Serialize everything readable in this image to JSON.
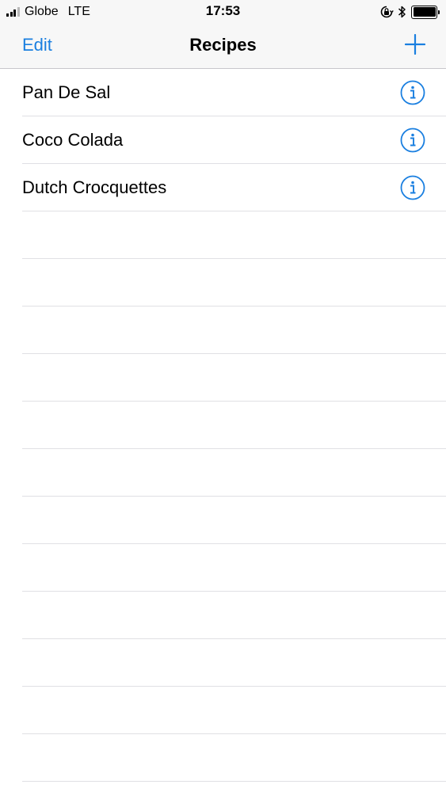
{
  "status_bar": {
    "carrier": "Globe",
    "network": "LTE",
    "time": "17:53",
    "signal_bars_active": 3,
    "signal_bars_total": 4,
    "icons": [
      "signal-icon",
      "orientation-lock-icon",
      "bluetooth-icon",
      "battery-icon"
    ],
    "battery_level": 1.0
  },
  "nav": {
    "edit_label": "Edit",
    "title": "Recipes",
    "add_icon": "plus-icon"
  },
  "recipes": [
    {
      "name": "Pan De Sal",
      "accessory_icon": "info-icon"
    },
    {
      "name": "Coco Colada",
      "accessory_icon": "info-icon"
    },
    {
      "name": "Dutch Crocquettes",
      "accessory_icon": "info-icon"
    }
  ],
  "colors": {
    "tint": "#1a7fe0",
    "bar_background": "#f7f7f7",
    "separator": "#e0e0e4"
  }
}
